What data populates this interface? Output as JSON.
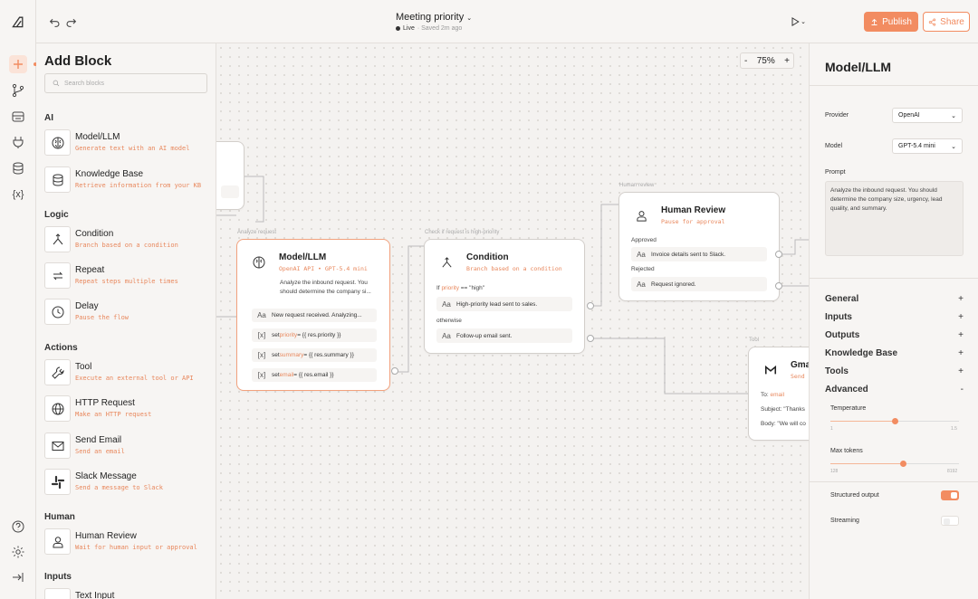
{
  "topbar": {
    "title": "Meeting priority",
    "status_live": "Live",
    "status_saved": "· Saved 2m ago",
    "publish_label": "Publish",
    "share_label": "Share"
  },
  "rail": {
    "icons": [
      "logo-icon",
      "plus-icon",
      "branch-icon",
      "inbox-icon",
      "plug-icon",
      "database-icon",
      "variable-icon",
      "help-icon",
      "settings-icon",
      "collapse-icon"
    ]
  },
  "left_panel": {
    "title": "Add Block",
    "search_placeholder": "Search blocks",
    "sections": [
      {
        "label": "AI",
        "blocks": [
          {
            "name": "Model/LLM",
            "desc": "Generate text with an AI model",
            "icon": "brain-icon"
          },
          {
            "name": "Knowledge Base",
            "desc": "Retrieve information from your KB",
            "icon": "database-icon"
          }
        ]
      },
      {
        "label": "Logic",
        "blocks": [
          {
            "name": "Condition",
            "desc": "Branch based on a condition",
            "icon": "branch-icon"
          },
          {
            "name": "Repeat",
            "desc": "Repeat steps multiple times",
            "icon": "repeat-icon"
          },
          {
            "name": "Delay",
            "desc": "Pause the flow",
            "icon": "clock-icon"
          }
        ]
      },
      {
        "label": "Actions",
        "blocks": [
          {
            "name": "Tool",
            "desc": "Execute an external tool or API",
            "icon": "wrench-icon"
          },
          {
            "name": "HTTP Request",
            "desc": "Make an HTTP request",
            "icon": "globe-icon"
          },
          {
            "name": "Send Email",
            "desc": "Send an email",
            "icon": "mail-icon"
          },
          {
            "name": "Slack Message",
            "desc": "Send a message to Slack",
            "icon": "slack-icon"
          }
        ]
      },
      {
        "label": "Human",
        "blocks": [
          {
            "name": "Human Review",
            "desc": "Wait for human input or approval",
            "icon": "user-icon"
          }
        ]
      },
      {
        "label": "Inputs",
        "blocks": [
          {
            "name": "Text Input",
            "desc": "",
            "icon": "text-icon"
          }
        ]
      }
    ]
  },
  "canvas": {
    "zoom_minus": "-",
    "zoom_level": "75%",
    "zoom_plus": "+",
    "model_node": {
      "caption": "Analyze request",
      "title": "Model/LLM",
      "subtitle": "OpenAI API • GPT-5.4 mini",
      "desc": "Analyze the inbound request. You should determine the company si...",
      "rows": [
        {
          "glyph": "Aa",
          "pre": "New request received. Analyzing...",
          "var": "",
          "post": ""
        },
        {
          "glyph": "[x]",
          "pre": "set ",
          "var": "priority",
          "post": " = {{ res.priority }}"
        },
        {
          "glyph": "[x]",
          "pre": "set ",
          "var": "summary",
          "post": " = {{ res.summary }}"
        },
        {
          "glyph": "[x]",
          "pre": "set ",
          "var": "email",
          "post": " = {{ res.email }}"
        }
      ]
    },
    "condition_node": {
      "caption": "Check if request is high-priority",
      "title": "Condition",
      "subtitle": "Branch based on a condition",
      "if_label": "If",
      "if_var": "priority",
      "if_op": " == \"high\"",
      "row1": "High-priority lead sent to sales.",
      "otherwise_label": "otherwise",
      "row2": "Follow-up email sent."
    },
    "review_node": {
      "caption": "Human review",
      "title": "Human Review",
      "subtitle": "Pause for approval",
      "approved_label": "Approved",
      "approved_row": "Invoice details sent to Slack.",
      "rejected_label": "Rejected",
      "rejected_row": "Request ignored."
    },
    "gmail_node": {
      "caption": "Tool",
      "title": "Gma",
      "subtitle": "Send",
      "to_label": "To:",
      "to_value": "email",
      "subject": "Subject: \"Thanks",
      "body": "Body: \"We will co"
    }
  },
  "right_panel": {
    "title": "Model/LLM",
    "provider_label": "Provider",
    "provider_value": "OpenAI",
    "model_label": "Model",
    "model_value": "GPT-5.4 mini",
    "prompt_label": "Prompt",
    "prompt_text": "Analyze the inbound request. You should determine the company size, urgency, lead quality, and summary.",
    "sections": [
      {
        "label": "General",
        "sign": "+"
      },
      {
        "label": "Inputs",
        "sign": "+"
      },
      {
        "label": "Outputs",
        "sign": "+"
      },
      {
        "label": "Knowledge Base",
        "sign": "+"
      },
      {
        "label": "Tools",
        "sign": "+"
      },
      {
        "label": "Advanced",
        "sign": "-"
      }
    ],
    "temperature_label": "Temperature",
    "temperature_min": "1",
    "temperature_max": "1.5",
    "temperature_fraction": 0.5,
    "max_tokens_label": "Max tokens",
    "max_tokens_min": "128",
    "max_tokens_max": "8192",
    "max_tokens_fraction": 0.57,
    "structured_label": "Structured output",
    "structured_on": true,
    "streaming_label": "Streaming",
    "streaming_on": false,
    "accent_color": "#f28c61"
  }
}
